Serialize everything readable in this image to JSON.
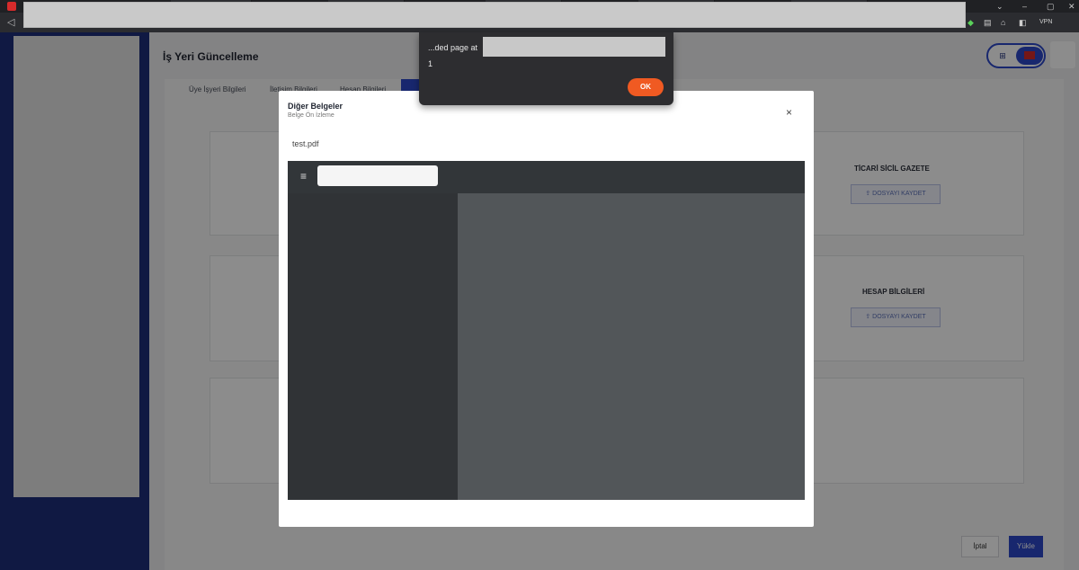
{
  "browser": {
    "window_controls": [
      "⌄",
      "–",
      "▢",
      "✕"
    ],
    "vpn_label": "VPN"
  },
  "app": {
    "page_title": "İş Yeri Güncelleme",
    "tabs": [
      {
        "label": "Üye İşyeri Bilgileri"
      },
      {
        "label": "İletişim Bilgileri"
      },
      {
        "label": "Hesap Bilgileri"
      }
    ],
    "cards": [
      {
        "title": "TİCARİ SİCİL GAZETE",
        "button": "DOSYAYI KAYDET"
      },
      {
        "title": "HESAP BİLGİLERİ",
        "button": "DOSYAYI KAYDET"
      }
    ],
    "cancel_label": "İptal",
    "upload_label": "Yükle",
    "lang_uk_icon": "uk-flag-icon",
    "lang_tr_icon": "tr-flag-icon"
  },
  "modal": {
    "title": "Diğer Belgeler",
    "subtitle": "Belge Ön İzleme",
    "close_glyph": "×",
    "file_name": "test.pdf",
    "menu_glyph": "≡"
  },
  "alert": {
    "prefix_text": "...ded page at",
    "message": "1",
    "ok_label": "OK"
  },
  "colors": {
    "brand_blue": "#2c47c8",
    "sidebar_blue": "#1e2e7a",
    "ok_orange": "#f05a22"
  }
}
